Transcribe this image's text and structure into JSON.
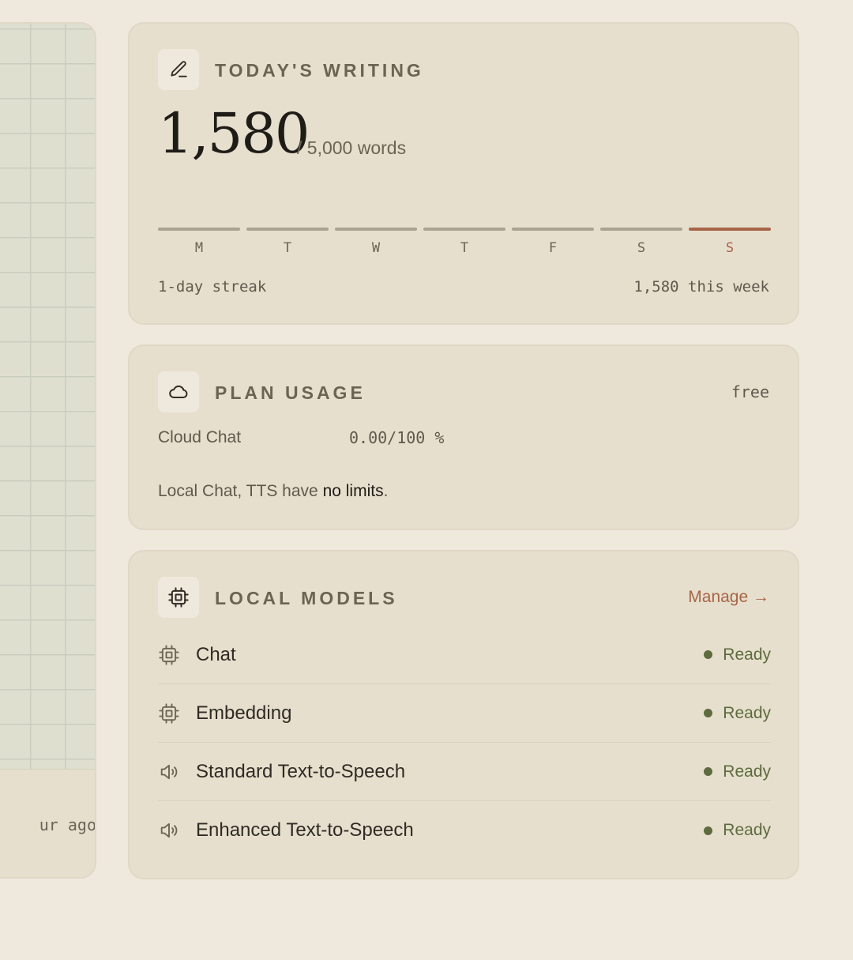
{
  "left_panel": {
    "time_text": "ur ago"
  },
  "writing": {
    "title": "TODAY'S WRITING",
    "icon": "pencil-icon",
    "count": "1,580",
    "goal": "/ 5,000 words",
    "days": [
      {
        "label": "M",
        "active": false
      },
      {
        "label": "T",
        "active": false
      },
      {
        "label": "W",
        "active": false
      },
      {
        "label": "T",
        "active": false
      },
      {
        "label": "F",
        "active": false
      },
      {
        "label": "S",
        "active": false
      },
      {
        "label": "S",
        "active": true
      }
    ],
    "streak": "1-day streak",
    "week_total": "1,580 this week"
  },
  "plan": {
    "title": "PLAN USAGE",
    "icon": "cloud-icon",
    "badge": "free",
    "row_label": "Cloud Chat",
    "row_value": "0.00/100 %",
    "note_prefix": "Local Chat, TTS have ",
    "note_strong": "no limits",
    "note_suffix": "."
  },
  "models": {
    "title": "LOCAL MODELS",
    "icon": "chip-icon",
    "manage_label": "Manage →",
    "items": [
      {
        "name": "Chat",
        "status": "Ready",
        "icon": "chip-icon"
      },
      {
        "name": "Embedding",
        "status": "Ready",
        "icon": "chip-icon"
      },
      {
        "name": "Standard Text-to-Speech",
        "status": "Ready",
        "icon": "speaker-icon"
      },
      {
        "name": "Enhanced Text-to-Speech",
        "status": "Ready",
        "icon": "speaker-icon"
      }
    ]
  },
  "colors": {
    "background": "#efe8dc",
    "card": "#e6dfcd",
    "accent": "#a86448",
    "ready": "#5d6b3e"
  }
}
